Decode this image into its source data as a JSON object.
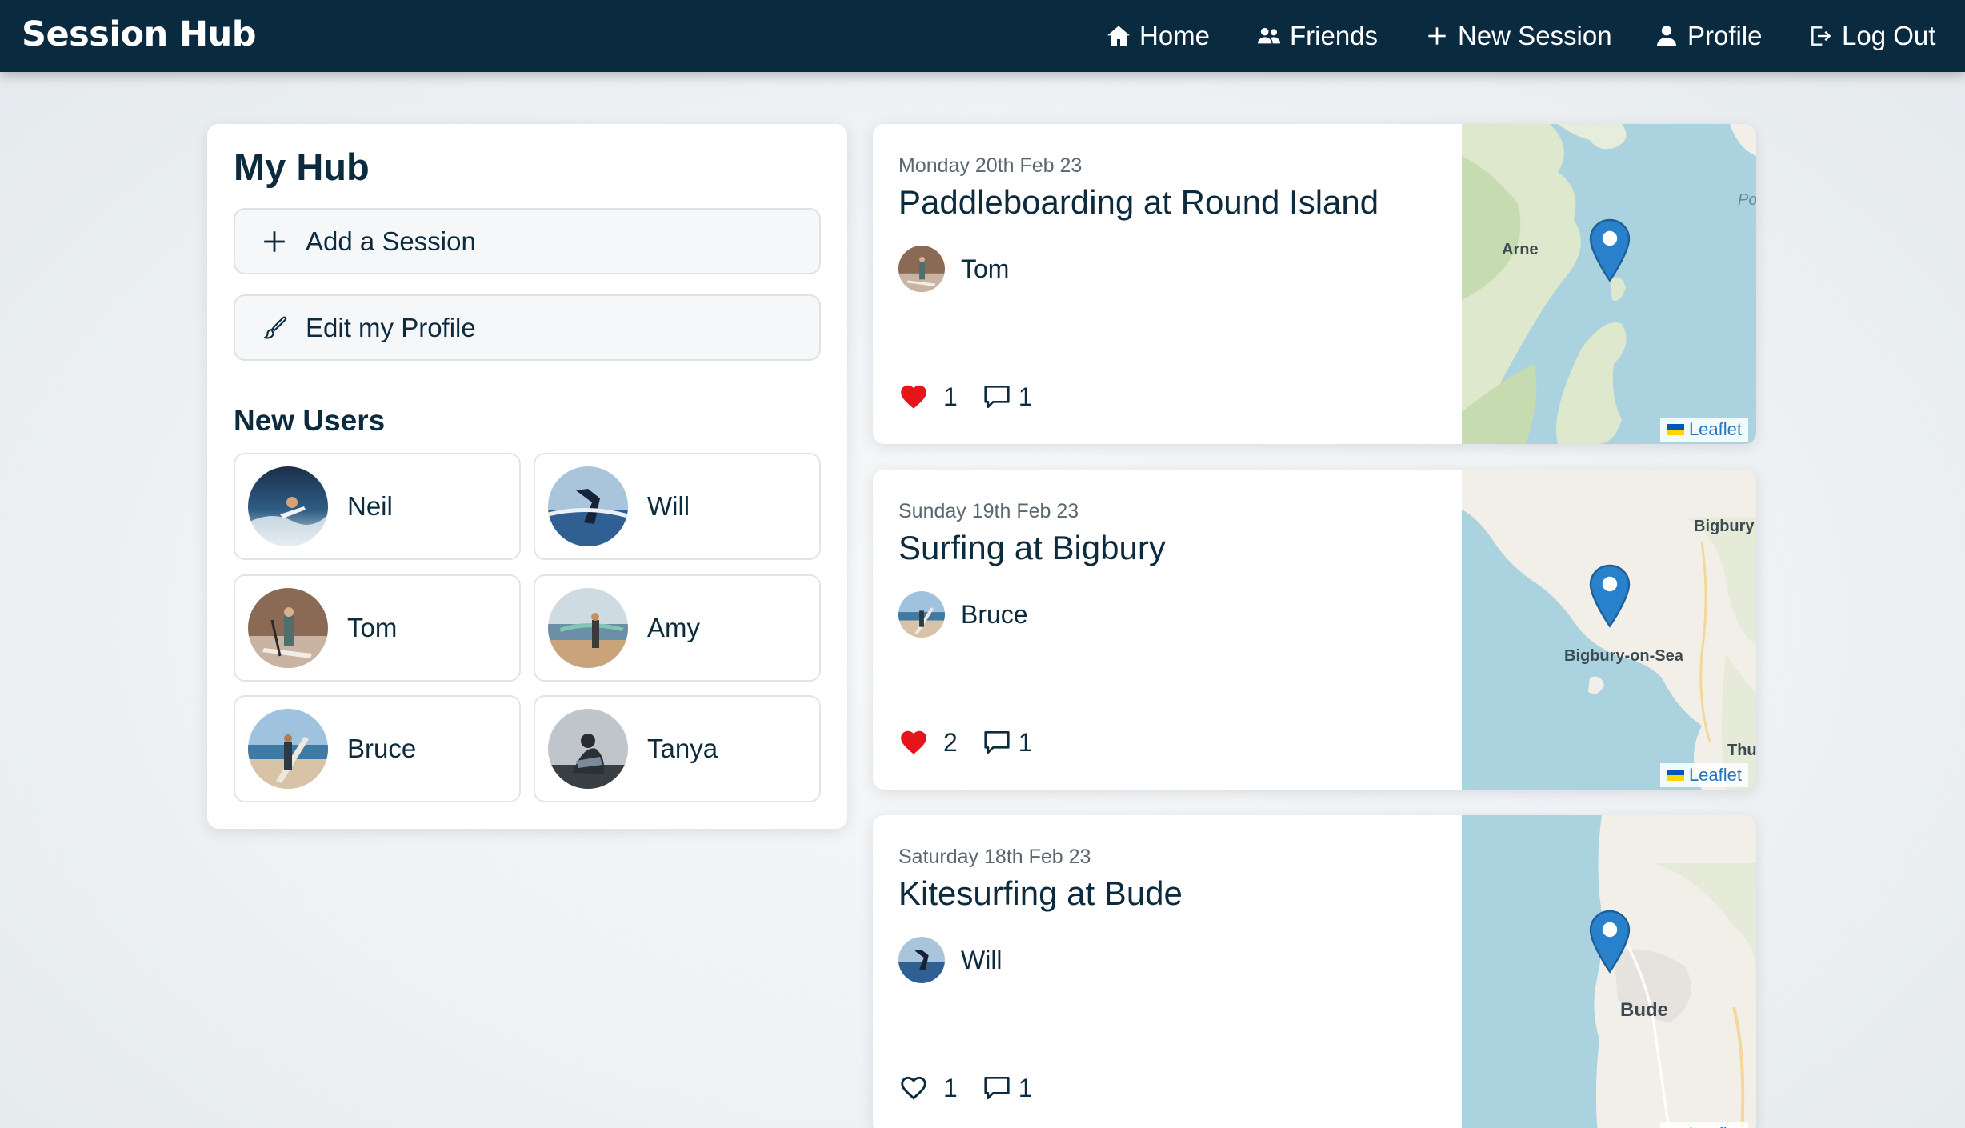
{
  "nav": {
    "brand": "Session Hub",
    "items": [
      {
        "label": "Home",
        "icon": "home-icon"
      },
      {
        "label": "Friends",
        "icon": "friends-icon"
      },
      {
        "label": "New Session",
        "icon": "plus-icon"
      },
      {
        "label": "Profile",
        "icon": "user-icon"
      },
      {
        "label": "Log Out",
        "icon": "logout-icon"
      }
    ]
  },
  "hub": {
    "title": "My Hub",
    "add_session": "Add a Session",
    "edit_profile": "Edit my Profile",
    "new_users_title": "New Users",
    "users": [
      "Neil",
      "Will",
      "Tom",
      "Amy",
      "Bruce",
      "Tanya"
    ]
  },
  "sessions": [
    {
      "date": "Monday 20th Feb 23",
      "title": "Paddleboarding at Round Island",
      "user": "Tom",
      "likes": "1",
      "comments": "1",
      "liked": true,
      "map_labels": [
        "Arne",
        "Po"
      ]
    },
    {
      "date": "Sunday 19th Feb 23",
      "title": "Surfing at Bigbury",
      "user": "Bruce",
      "likes": "2",
      "comments": "1",
      "liked": true,
      "map_labels": [
        "Bigbury",
        "Bigbury-on-Sea",
        "Thu"
      ]
    },
    {
      "date": "Saturday 18th Feb 23",
      "title": "Kitesurfing at Bude",
      "user": "Will",
      "likes": "1",
      "comments": "1",
      "liked": false,
      "map_labels": [
        "Bude"
      ]
    }
  ],
  "map": {
    "attribution": "Leaflet"
  },
  "colors": {
    "navbar": "#0a2a40",
    "text": "#0d2b3e",
    "heart": "#e8141b",
    "pin": "#2a81cb",
    "link": "#2776b8"
  }
}
